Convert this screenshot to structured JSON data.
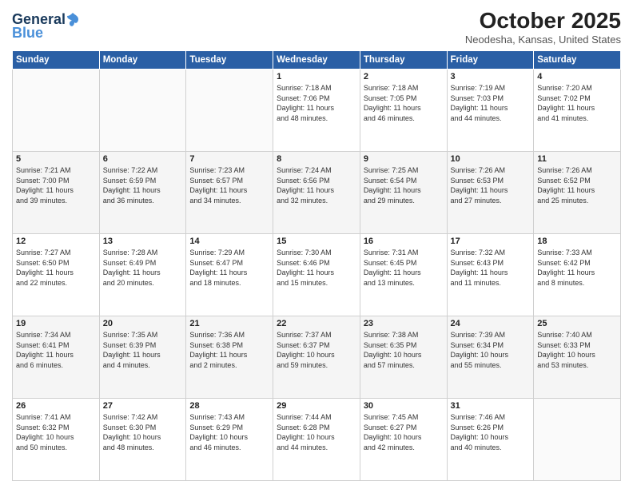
{
  "header": {
    "logo_line1": "General",
    "logo_line2": "Blue",
    "month_title": "October 2025",
    "location": "Neodesha, Kansas, United States"
  },
  "weekdays": [
    "Sunday",
    "Monday",
    "Tuesday",
    "Wednesday",
    "Thursday",
    "Friday",
    "Saturday"
  ],
  "weeks": [
    [
      {
        "day": "",
        "info": ""
      },
      {
        "day": "",
        "info": ""
      },
      {
        "day": "",
        "info": ""
      },
      {
        "day": "1",
        "info": "Sunrise: 7:18 AM\nSunset: 7:06 PM\nDaylight: 11 hours\nand 48 minutes."
      },
      {
        "day": "2",
        "info": "Sunrise: 7:18 AM\nSunset: 7:05 PM\nDaylight: 11 hours\nand 46 minutes."
      },
      {
        "day": "3",
        "info": "Sunrise: 7:19 AM\nSunset: 7:03 PM\nDaylight: 11 hours\nand 44 minutes."
      },
      {
        "day": "4",
        "info": "Sunrise: 7:20 AM\nSunset: 7:02 PM\nDaylight: 11 hours\nand 41 minutes."
      }
    ],
    [
      {
        "day": "5",
        "info": "Sunrise: 7:21 AM\nSunset: 7:00 PM\nDaylight: 11 hours\nand 39 minutes."
      },
      {
        "day": "6",
        "info": "Sunrise: 7:22 AM\nSunset: 6:59 PM\nDaylight: 11 hours\nand 36 minutes."
      },
      {
        "day": "7",
        "info": "Sunrise: 7:23 AM\nSunset: 6:57 PM\nDaylight: 11 hours\nand 34 minutes."
      },
      {
        "day": "8",
        "info": "Sunrise: 7:24 AM\nSunset: 6:56 PM\nDaylight: 11 hours\nand 32 minutes."
      },
      {
        "day": "9",
        "info": "Sunrise: 7:25 AM\nSunset: 6:54 PM\nDaylight: 11 hours\nand 29 minutes."
      },
      {
        "day": "10",
        "info": "Sunrise: 7:26 AM\nSunset: 6:53 PM\nDaylight: 11 hours\nand 27 minutes."
      },
      {
        "day": "11",
        "info": "Sunrise: 7:26 AM\nSunset: 6:52 PM\nDaylight: 11 hours\nand 25 minutes."
      }
    ],
    [
      {
        "day": "12",
        "info": "Sunrise: 7:27 AM\nSunset: 6:50 PM\nDaylight: 11 hours\nand 22 minutes."
      },
      {
        "day": "13",
        "info": "Sunrise: 7:28 AM\nSunset: 6:49 PM\nDaylight: 11 hours\nand 20 minutes."
      },
      {
        "day": "14",
        "info": "Sunrise: 7:29 AM\nSunset: 6:47 PM\nDaylight: 11 hours\nand 18 minutes."
      },
      {
        "day": "15",
        "info": "Sunrise: 7:30 AM\nSunset: 6:46 PM\nDaylight: 11 hours\nand 15 minutes."
      },
      {
        "day": "16",
        "info": "Sunrise: 7:31 AM\nSunset: 6:45 PM\nDaylight: 11 hours\nand 13 minutes."
      },
      {
        "day": "17",
        "info": "Sunrise: 7:32 AM\nSunset: 6:43 PM\nDaylight: 11 hours\nand 11 minutes."
      },
      {
        "day": "18",
        "info": "Sunrise: 7:33 AM\nSunset: 6:42 PM\nDaylight: 11 hours\nand 8 minutes."
      }
    ],
    [
      {
        "day": "19",
        "info": "Sunrise: 7:34 AM\nSunset: 6:41 PM\nDaylight: 11 hours\nand 6 minutes."
      },
      {
        "day": "20",
        "info": "Sunrise: 7:35 AM\nSunset: 6:39 PM\nDaylight: 11 hours\nand 4 minutes."
      },
      {
        "day": "21",
        "info": "Sunrise: 7:36 AM\nSunset: 6:38 PM\nDaylight: 11 hours\nand 2 minutes."
      },
      {
        "day": "22",
        "info": "Sunrise: 7:37 AM\nSunset: 6:37 PM\nDaylight: 10 hours\nand 59 minutes."
      },
      {
        "day": "23",
        "info": "Sunrise: 7:38 AM\nSunset: 6:35 PM\nDaylight: 10 hours\nand 57 minutes."
      },
      {
        "day": "24",
        "info": "Sunrise: 7:39 AM\nSunset: 6:34 PM\nDaylight: 10 hours\nand 55 minutes."
      },
      {
        "day": "25",
        "info": "Sunrise: 7:40 AM\nSunset: 6:33 PM\nDaylight: 10 hours\nand 53 minutes."
      }
    ],
    [
      {
        "day": "26",
        "info": "Sunrise: 7:41 AM\nSunset: 6:32 PM\nDaylight: 10 hours\nand 50 minutes."
      },
      {
        "day": "27",
        "info": "Sunrise: 7:42 AM\nSunset: 6:30 PM\nDaylight: 10 hours\nand 48 minutes."
      },
      {
        "day": "28",
        "info": "Sunrise: 7:43 AM\nSunset: 6:29 PM\nDaylight: 10 hours\nand 46 minutes."
      },
      {
        "day": "29",
        "info": "Sunrise: 7:44 AM\nSunset: 6:28 PM\nDaylight: 10 hours\nand 44 minutes."
      },
      {
        "day": "30",
        "info": "Sunrise: 7:45 AM\nSunset: 6:27 PM\nDaylight: 10 hours\nand 42 minutes."
      },
      {
        "day": "31",
        "info": "Sunrise: 7:46 AM\nSunset: 6:26 PM\nDaylight: 10 hours\nand 40 minutes."
      },
      {
        "day": "",
        "info": ""
      }
    ]
  ]
}
